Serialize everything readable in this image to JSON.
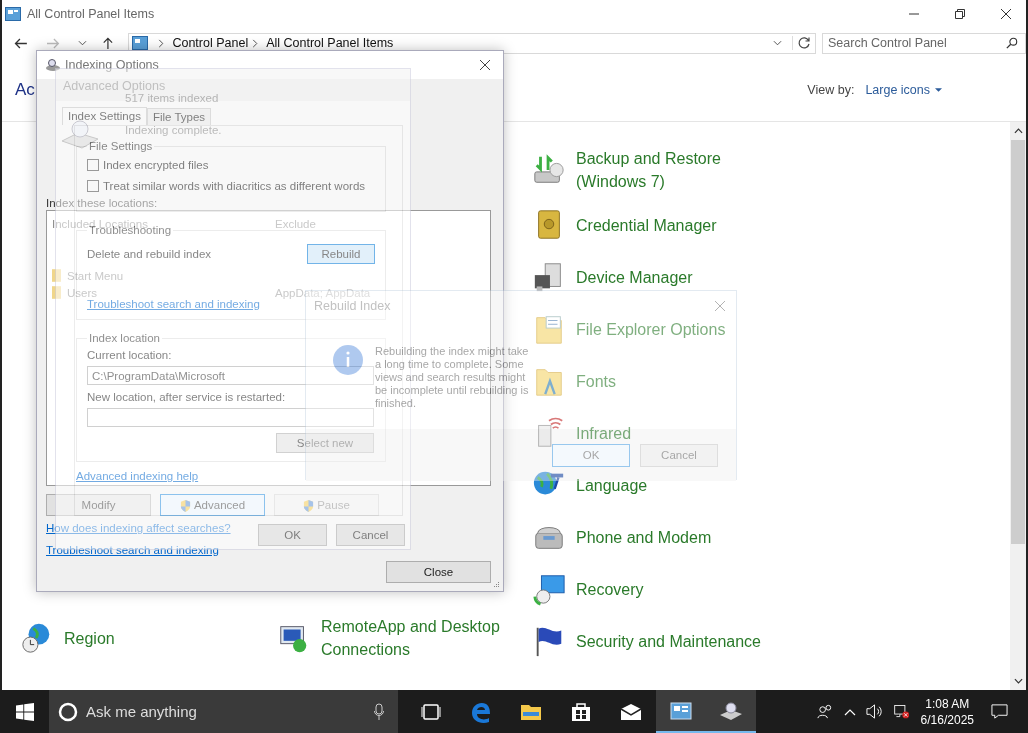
{
  "window": {
    "title": "All Control Panel Items"
  },
  "address": {
    "crumbs": [
      "Control Panel",
      "All Control Panel Items"
    ]
  },
  "search": {
    "placeholder": "Search Control Panel"
  },
  "heading": "Ac",
  "view_by": {
    "label": "View by:",
    "value": "Large icons"
  },
  "columns": [
    [
      {
        "label": "Region",
        "kind": "region"
      }
    ],
    [
      {
        "label": "RemoteApp and Desktop Connections",
        "kind": "remoteapp"
      }
    ],
    [
      {
        "label": "Backup and Restore (Windows 7)",
        "kind": "backup"
      },
      {
        "label": "Credential Manager",
        "kind": "credential"
      },
      {
        "label": "Device Manager",
        "kind": "device"
      },
      {
        "label": "File Explorer Options",
        "kind": "folder"
      },
      {
        "label": "Fonts",
        "kind": "fonts"
      },
      {
        "label": "Infrared",
        "kind": "infrared"
      },
      {
        "label": "Language",
        "kind": "language"
      },
      {
        "label": "Phone and Modem",
        "kind": "phone"
      },
      {
        "label": "Recovery",
        "kind": "recovery"
      },
      {
        "label": "Security and Maintenance",
        "kind": "security"
      }
    ]
  ],
  "indexing": {
    "title": "Indexing Options",
    "count": "517 items indexed",
    "status": "Indexing complete.",
    "locations_label": "Index these locations:",
    "columns": [
      "Included Locations",
      "Exclude"
    ],
    "rows": [
      {
        "location": "Start Menu"
      },
      {
        "location": "Users",
        "exclude": "AppData; AppData"
      }
    ],
    "buttons": [
      {
        "label": "Modify",
        "kind": "plain",
        "disabled": false
      },
      {
        "label": "Advanced",
        "kind": "shield",
        "disabled": false
      },
      {
        "label": "Pause",
        "kind": "shield",
        "disabled": true
      }
    ],
    "links": [
      "How does indexing affect searches?",
      "Troubleshoot search and indexing"
    ],
    "close": "Close"
  },
  "advanced": {
    "title": "Advanced Options",
    "tabs": [
      {
        "label": "Index Settings",
        "selected": true
      },
      {
        "label": "File Types",
        "selected": false
      }
    ],
    "file_settings": {
      "title": "File Settings",
      "options": [
        {
          "label": "Index encrypted files",
          "checked": false
        },
        {
          "label": "Treat similar words with diacritics as different words",
          "checked": false
        }
      ]
    },
    "troubleshooting": {
      "title": "Troubleshooting",
      "text": "Delete and rebuild index",
      "button": "Rebuild",
      "link": "Troubleshoot search and indexing"
    },
    "index_location": {
      "title": "Index location",
      "current_label": "Current location:",
      "current_value": "C:\\ProgramData\\Microsoft",
      "new_label": "New location, after service is restarted:",
      "button": "Select new"
    },
    "help_link": "Advanced indexing help",
    "buttons": [
      "OK",
      "Cancel"
    ]
  },
  "rebuild": {
    "title": "Rebuild Index",
    "message": "Rebuilding the index might take a long time to complete. Some views and search results might be incomplete until rebuilding is finished.",
    "buttons": [
      "OK",
      "Cancel"
    ]
  },
  "taskbar": {
    "search_placeholder": "Ask me anything",
    "apps": [
      {
        "kind": "task-view",
        "active": false
      },
      {
        "kind": "edge",
        "active": false
      },
      {
        "kind": "explorer",
        "active": false
      },
      {
        "kind": "store",
        "active": false
      },
      {
        "kind": "mail",
        "active": false
      },
      {
        "kind": "control-panel",
        "active": true
      },
      {
        "kind": "indexing",
        "active": true
      }
    ],
    "time": "1:08 AM",
    "date": "6/16/2025"
  }
}
